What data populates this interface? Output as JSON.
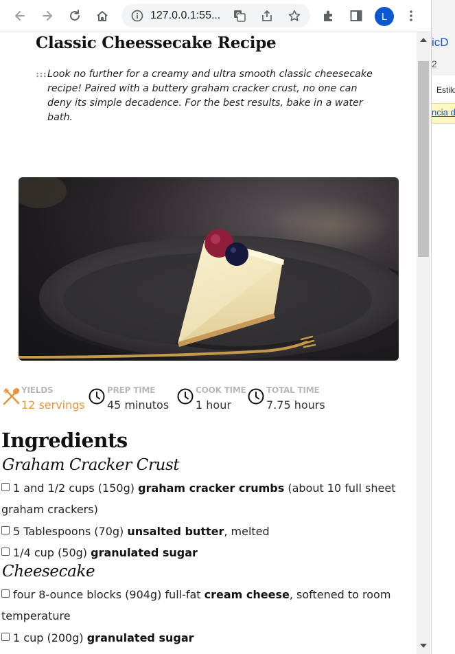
{
  "browser": {
    "url": "127.0.0.1:55...",
    "profile_initial": "L"
  },
  "background_window": {
    "text_top": "icD",
    "text_num": "2",
    "text_label": "Estilo",
    "text_link": "ncia d"
  },
  "recipe": {
    "title": "Classic Cheessecake Recipe",
    "summary": "Look no further for a creamy and ultra smooth classic cheesecake recipe! Paired with a buttery graham cracker crust, no one can deny its simple decadence. For the best results, bake in a water bath.",
    "stats": [
      {
        "label": "YIELDS",
        "value": "12 servings",
        "icon": "utensils-icon"
      },
      {
        "label": "PREP TIME",
        "value": "45 minutos",
        "icon": "clock-icon"
      },
      {
        "label": "COOK TIME",
        "value": "1 hour",
        "icon": "clock-icon"
      },
      {
        "label": "TOTAL TIME",
        "value": "7.75 hours",
        "icon": "clock-icon"
      }
    ],
    "accent_color": "#e8943a",
    "ingredients_heading": "Ingredients",
    "sections": [
      {
        "title": "Graham Cracker Crust",
        "items": [
          {
            "pre": "1 and 1/2 cups (150g) ",
            "bold": "graham cracker crumbs",
            "post": " (about 10 full sheet graham crackers)"
          },
          {
            "pre": "5 Tablespoons (70g) ",
            "bold": "unsalted butter",
            "post": ", melted"
          },
          {
            "pre": "1/4 cup (50g) ",
            "bold": "granulated sugar",
            "post": ""
          }
        ]
      },
      {
        "title": "Cheesecake",
        "items": [
          {
            "pre": "four 8-ounce blocks (904g) full-fat ",
            "bold": "cream cheese",
            "post": ", softened to room temperature"
          },
          {
            "pre": "1 cup (200g) ",
            "bold": "granulated sugar",
            "post": ""
          }
        ]
      }
    ]
  }
}
